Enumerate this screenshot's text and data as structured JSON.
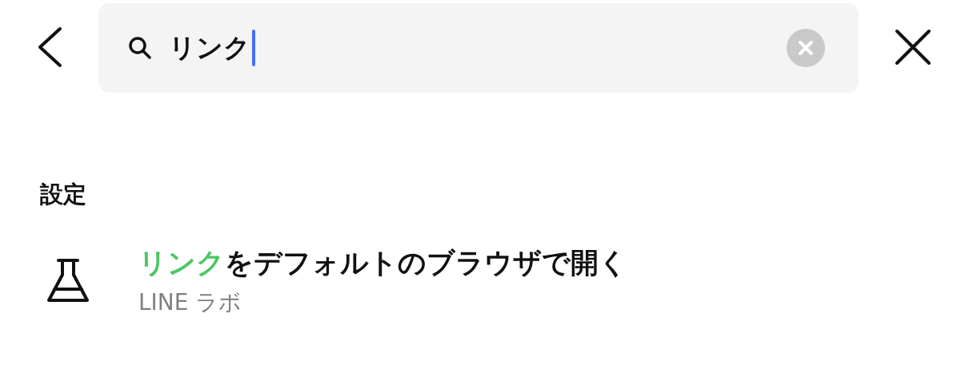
{
  "search": {
    "value": "リンク",
    "focused": true
  },
  "section": {
    "title": "設定"
  },
  "results": [
    {
      "title_parts": [
        {
          "text": "リンク",
          "highlight": true
        },
        {
          "text": "をデフォルトのブラウザで開く",
          "highlight": false
        }
      ],
      "subtitle": "LINE ラボ"
    }
  ]
}
